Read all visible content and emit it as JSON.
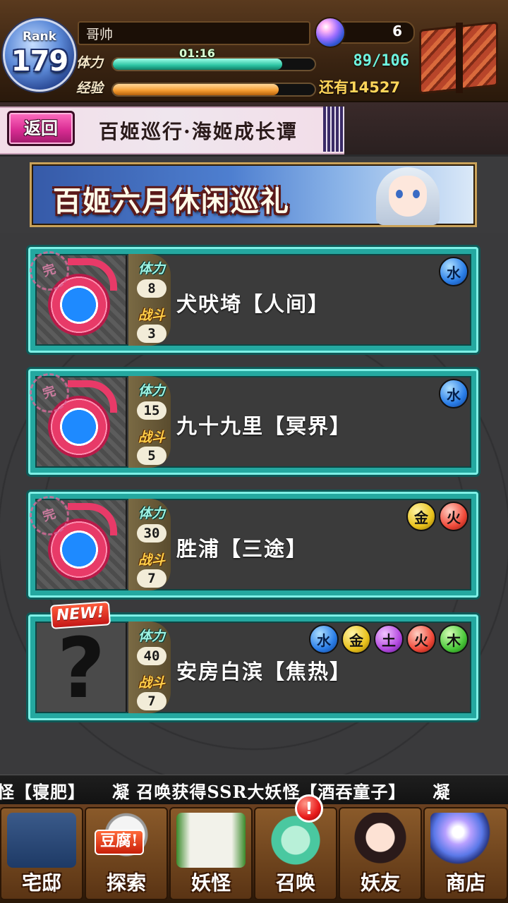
{
  "player": {
    "rank_label": "Rank",
    "rank_value": "179",
    "name": "哥帅",
    "stamina_label": "体力",
    "stamina_timer": "01:16",
    "stamina_value": "89/106",
    "stamina_fraction": 0.84,
    "exp_label": "经验",
    "exp_fraction": 0.82,
    "exp_remaining": "还有14527",
    "gem_count": "6"
  },
  "header": {
    "back_label": "返回",
    "title": "百姬巡行·海姬成长谭"
  },
  "banner": {
    "title": "百姬六月休闲巡礼"
  },
  "stage_labels": {
    "stamina": "体力",
    "battle": "战斗",
    "cleared_stamp": "完",
    "new_badge": "NEW!",
    "unknown_mark": "?"
  },
  "stages": [
    {
      "name": "犬吠埼【人间】",
      "stamina": "8",
      "battles": "3",
      "elements": [
        {
          "icon": "water-element-icon",
          "glyph": "水"
        }
      ],
      "cleared": true
    },
    {
      "name": "九十九里【冥界】",
      "stamina": "15",
      "battles": "5",
      "elements": [
        {
          "icon": "water-element-icon",
          "glyph": "水"
        }
      ],
      "cleared": true
    },
    {
      "name": "胜浦【三途】",
      "stamina": "30",
      "battles": "7",
      "elements": [
        {
          "icon": "metal-element-icon",
          "glyph": "金"
        },
        {
          "icon": "fire-element-icon",
          "glyph": "火"
        }
      ],
      "cleared": true
    },
    {
      "name": "安房白滨【焦热】",
      "stamina": "40",
      "battles": "7",
      "elements": [
        {
          "icon": "water-element-icon",
          "glyph": "水"
        },
        {
          "icon": "metal-element-icon",
          "glyph": "金"
        },
        {
          "icon": "earth-element-icon",
          "glyph": "土"
        },
        {
          "icon": "fire-element-icon",
          "glyph": "火"
        },
        {
          "icon": "wood-element-icon",
          "glyph": "木"
        }
      ],
      "cleared": false,
      "is_new": true
    }
  ],
  "ticker": {
    "text": "怪【寝肥】　　凝 召唤获得SSR大妖怪【酒吞童子】　　凝"
  },
  "bottom_nav": {
    "items": [
      "宅邸",
      "探索",
      "妖怪",
      "召唤",
      "妖友",
      "商店"
    ],
    "tofu_tag": "豆腐!",
    "alert": "!"
  },
  "colors": {
    "card_frame": "#24a8a0",
    "back_button": "#d92c93",
    "stamina_bar": "#2cc4a2",
    "exp_bar": "#f39a2e"
  }
}
